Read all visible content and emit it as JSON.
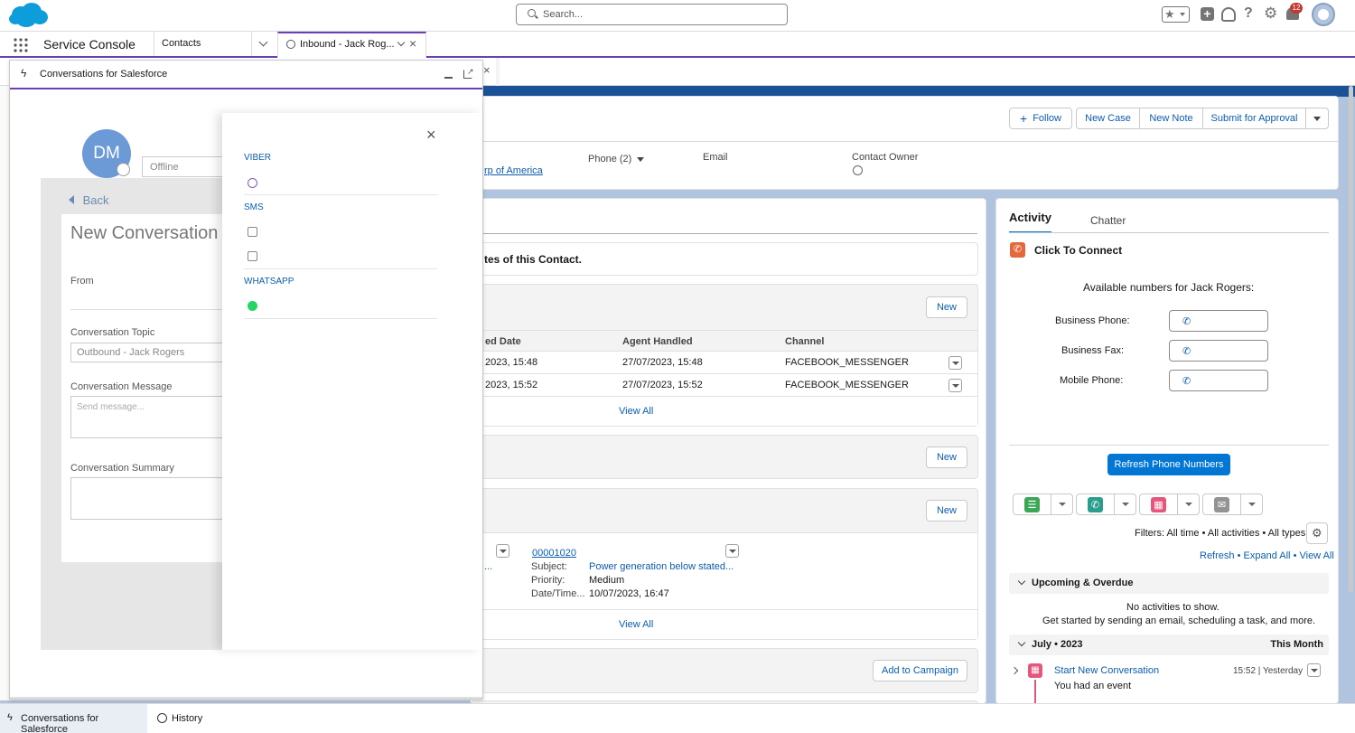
{
  "global": {
    "search_placeholder": "Search...",
    "notification_count": "12"
  },
  "nav": {
    "app_name": "Service Console",
    "tabs": [
      {
        "label": "Contacts"
      },
      {
        "label": "Inbound - Jack Rog..."
      }
    ]
  },
  "record": {
    "actions": {
      "follow": "Follow",
      "new_case": "New Case",
      "new_note": "New Note",
      "submit": "Submit for Approval"
    },
    "account_partial": "rp of America",
    "phone_label": "Phone (2)",
    "email_label": "Email",
    "owner_label": "Contact Owner"
  },
  "main": {
    "notice_partial": "tes of this Contact.",
    "conversations": {
      "new_label": "New",
      "columns": [
        "ed Date",
        "Agent Handled",
        "Channel"
      ],
      "rows": [
        {
          "date": "2023, 15:48",
          "agent": "27/07/2023, 15:48",
          "channel": "FACEBOOK_MESSENGER"
        },
        {
          "date": "2023, 15:52",
          "agent": "27/07/2023, 15:52",
          "channel": "FACEBOOK_MESSENGER"
        }
      ],
      "view_all": "View All"
    },
    "section2": {
      "new_label": "New"
    },
    "cases": {
      "new_label": "New",
      "case_number": "00001020",
      "subject_label": "Subject:",
      "subject_value": "Power generation below stated...",
      "priority_label": "Priority:",
      "priority_value": "Medium",
      "datetime_label": "Date/Time...",
      "datetime_value": "10/07/2023, 16:47",
      "left_partial": "...",
      "view_all": "View All"
    },
    "campaign": {
      "button": "Add to Campaign"
    }
  },
  "activity": {
    "tabs": [
      "Activity",
      "Chatter"
    ],
    "click_to_connect": "Click To Connect",
    "available_numbers": "Available numbers for Jack Rogers:",
    "phones": [
      {
        "label": "Business Phone:"
      },
      {
        "label": "Business Fax:"
      },
      {
        "label": "Mobile Phone:"
      }
    ],
    "refresh_button": "Refresh Phone Numbers",
    "filters": "Filters: All time • All activities • All types",
    "refresh": "Refresh",
    "expand_all": "Expand All",
    "view_all": "View All",
    "upcoming": "Upcoming & Overdue",
    "no_activities": "No activities to show.",
    "get_started": "Get started by sending an email, scheduling a task, and more.",
    "month": "July • 2023",
    "this_month": "This Month",
    "event_title": "Start New Conversation",
    "event_time": "15:52 | Yesterday",
    "event_desc": "You had an event"
  },
  "panel": {
    "title": "Conversations for Salesforce",
    "avatar_initials": "DM",
    "status": "Offline",
    "back": "Back",
    "heading": "New Conversation",
    "from_label": "From",
    "topic_label": "Conversation Topic",
    "topic_value": "Outbound - Jack Rogers",
    "message_label": "Conversation Message",
    "message_placeholder": "Send message...",
    "summary_label": "Conversation Summary",
    "channels": [
      {
        "name": "VIBER"
      },
      {
        "name": "SMS"
      },
      {
        "name": "WHATSAPP"
      }
    ]
  },
  "utility_bar": {
    "items": [
      "Conversations for Salesforce",
      "History"
    ]
  },
  "colors": {
    "brand_blue": "#0176d3",
    "link": "#0b5cab",
    "purple_accent": "#6c3fb4",
    "phone_orange": "#e5683a",
    "event_pink": "#e3577d"
  }
}
